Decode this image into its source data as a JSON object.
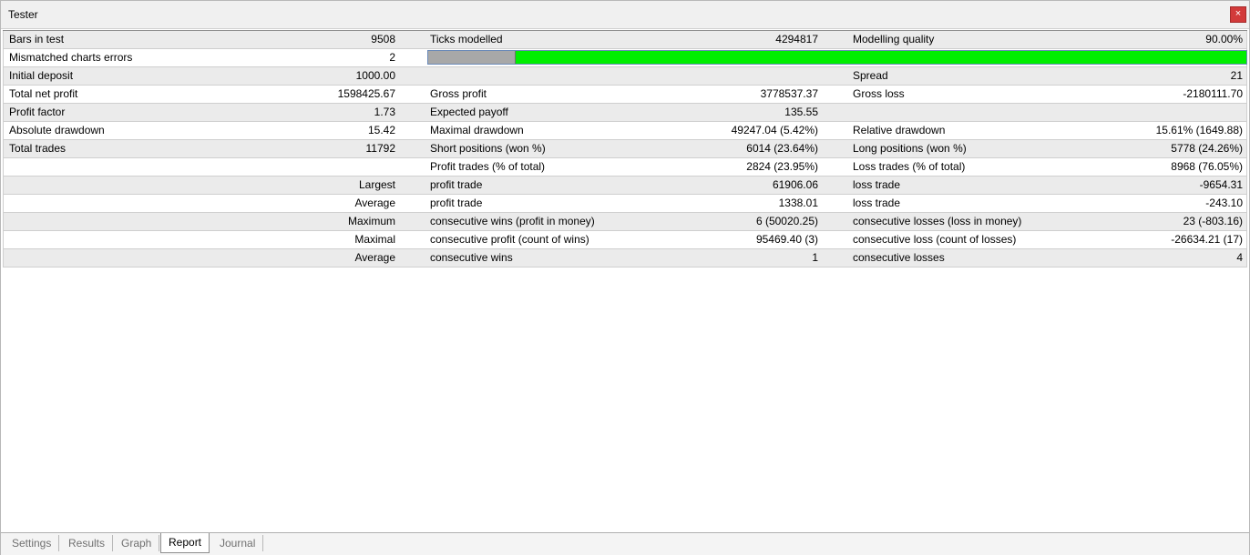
{
  "window": {
    "title": "Tester",
    "close_label": "×"
  },
  "modelling_quality": {
    "fraction_poor": 0.107
  },
  "rows": [
    [
      "Bars in test",
      "9508",
      "Ticks modelled",
      "4294817",
      "Modelling quality",
      "90.00%"
    ],
    [
      "Mismatched charts errors",
      "2",
      "",
      "",
      "",
      ""
    ],
    [
      "Initial deposit",
      "1000.00",
      "",
      "",
      "Spread",
      "21"
    ],
    [
      "Total net profit",
      "1598425.67",
      "Gross profit",
      "3778537.37",
      "Gross loss",
      "-2180111.70"
    ],
    [
      "Profit factor",
      "1.73",
      "Expected payoff",
      "135.55",
      "",
      ""
    ],
    [
      "Absolute drawdown",
      "15.42",
      "Maximal drawdown",
      "49247.04 (5.42%)",
      "Relative drawdown",
      "15.61% (1649.88)"
    ],
    [
      "Total trades",
      "11792",
      "Short positions (won %)",
      "6014 (23.64%)",
      "Long positions (won %)",
      "5778 (24.26%)"
    ],
    [
      "",
      "",
      "Profit trades (% of total)",
      "2824 (23.95%)",
      "Loss trades (% of total)",
      "8968 (76.05%)"
    ],
    [
      "",
      "Largest",
      "profit trade",
      "61906.06",
      "loss trade",
      "-9654.31"
    ],
    [
      "",
      "Average",
      "profit trade",
      "1338.01",
      "loss trade",
      "-243.10"
    ],
    [
      "",
      "Maximum",
      "consecutive wins (profit in money)",
      "6 (50020.25)",
      "consecutive losses (loss in money)",
      "23 (-803.16)"
    ],
    [
      "",
      "Maximal",
      "consecutive profit (count of wins)",
      "95469.40 (3)",
      "consecutive loss (count of losses)",
      "-26634.21 (17)"
    ],
    [
      "",
      "Average",
      "consecutive wins",
      "1",
      "consecutive losses",
      "4"
    ]
  ],
  "tabs": [
    {
      "label": "Settings",
      "active": false
    },
    {
      "label": "Results",
      "active": false
    },
    {
      "label": "Graph",
      "active": false
    },
    {
      "label": "Report",
      "active": true
    },
    {
      "label": "Journal",
      "active": false
    }
  ]
}
